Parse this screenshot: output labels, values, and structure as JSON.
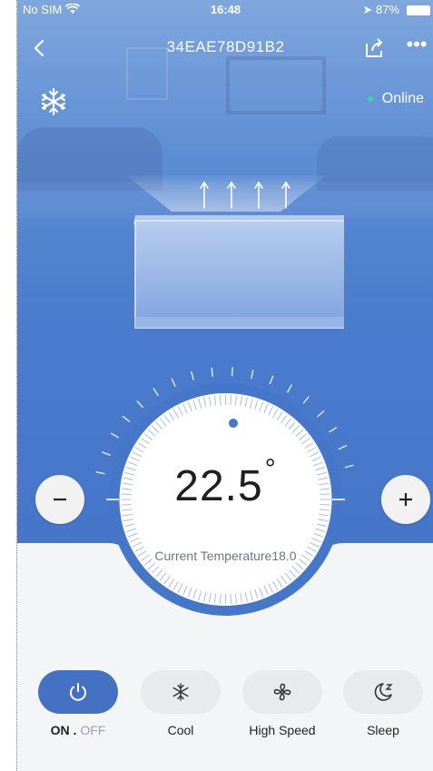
{
  "status_bar": {
    "carrier": "No SIM",
    "time": "16:48",
    "battery": "87%"
  },
  "nav": {
    "title": "34EAE78D91B2"
  },
  "device": {
    "status": "Online"
  },
  "thermostat": {
    "set_temp": "22.5",
    "unit": "°",
    "current_label": "Current Temperature18.0"
  },
  "controls": {
    "power": {
      "on_label": "ON",
      "separator": ".",
      "off_label": "OFF"
    },
    "mode": {
      "label": "Cool"
    },
    "fan": {
      "label": "High Speed"
    },
    "sleep": {
      "label": "Sleep"
    }
  },
  "icons": [
    "back-icon",
    "share-icon",
    "more-icon",
    "snowflake-icon",
    "power-icon",
    "fan-icon",
    "moon-sleep-icon",
    "minus-icon",
    "plus-icon"
  ],
  "colors": {
    "primary_blue": "#4a7bcc",
    "active_pill": "#4471c2",
    "online_dot": "#37d79c"
  }
}
